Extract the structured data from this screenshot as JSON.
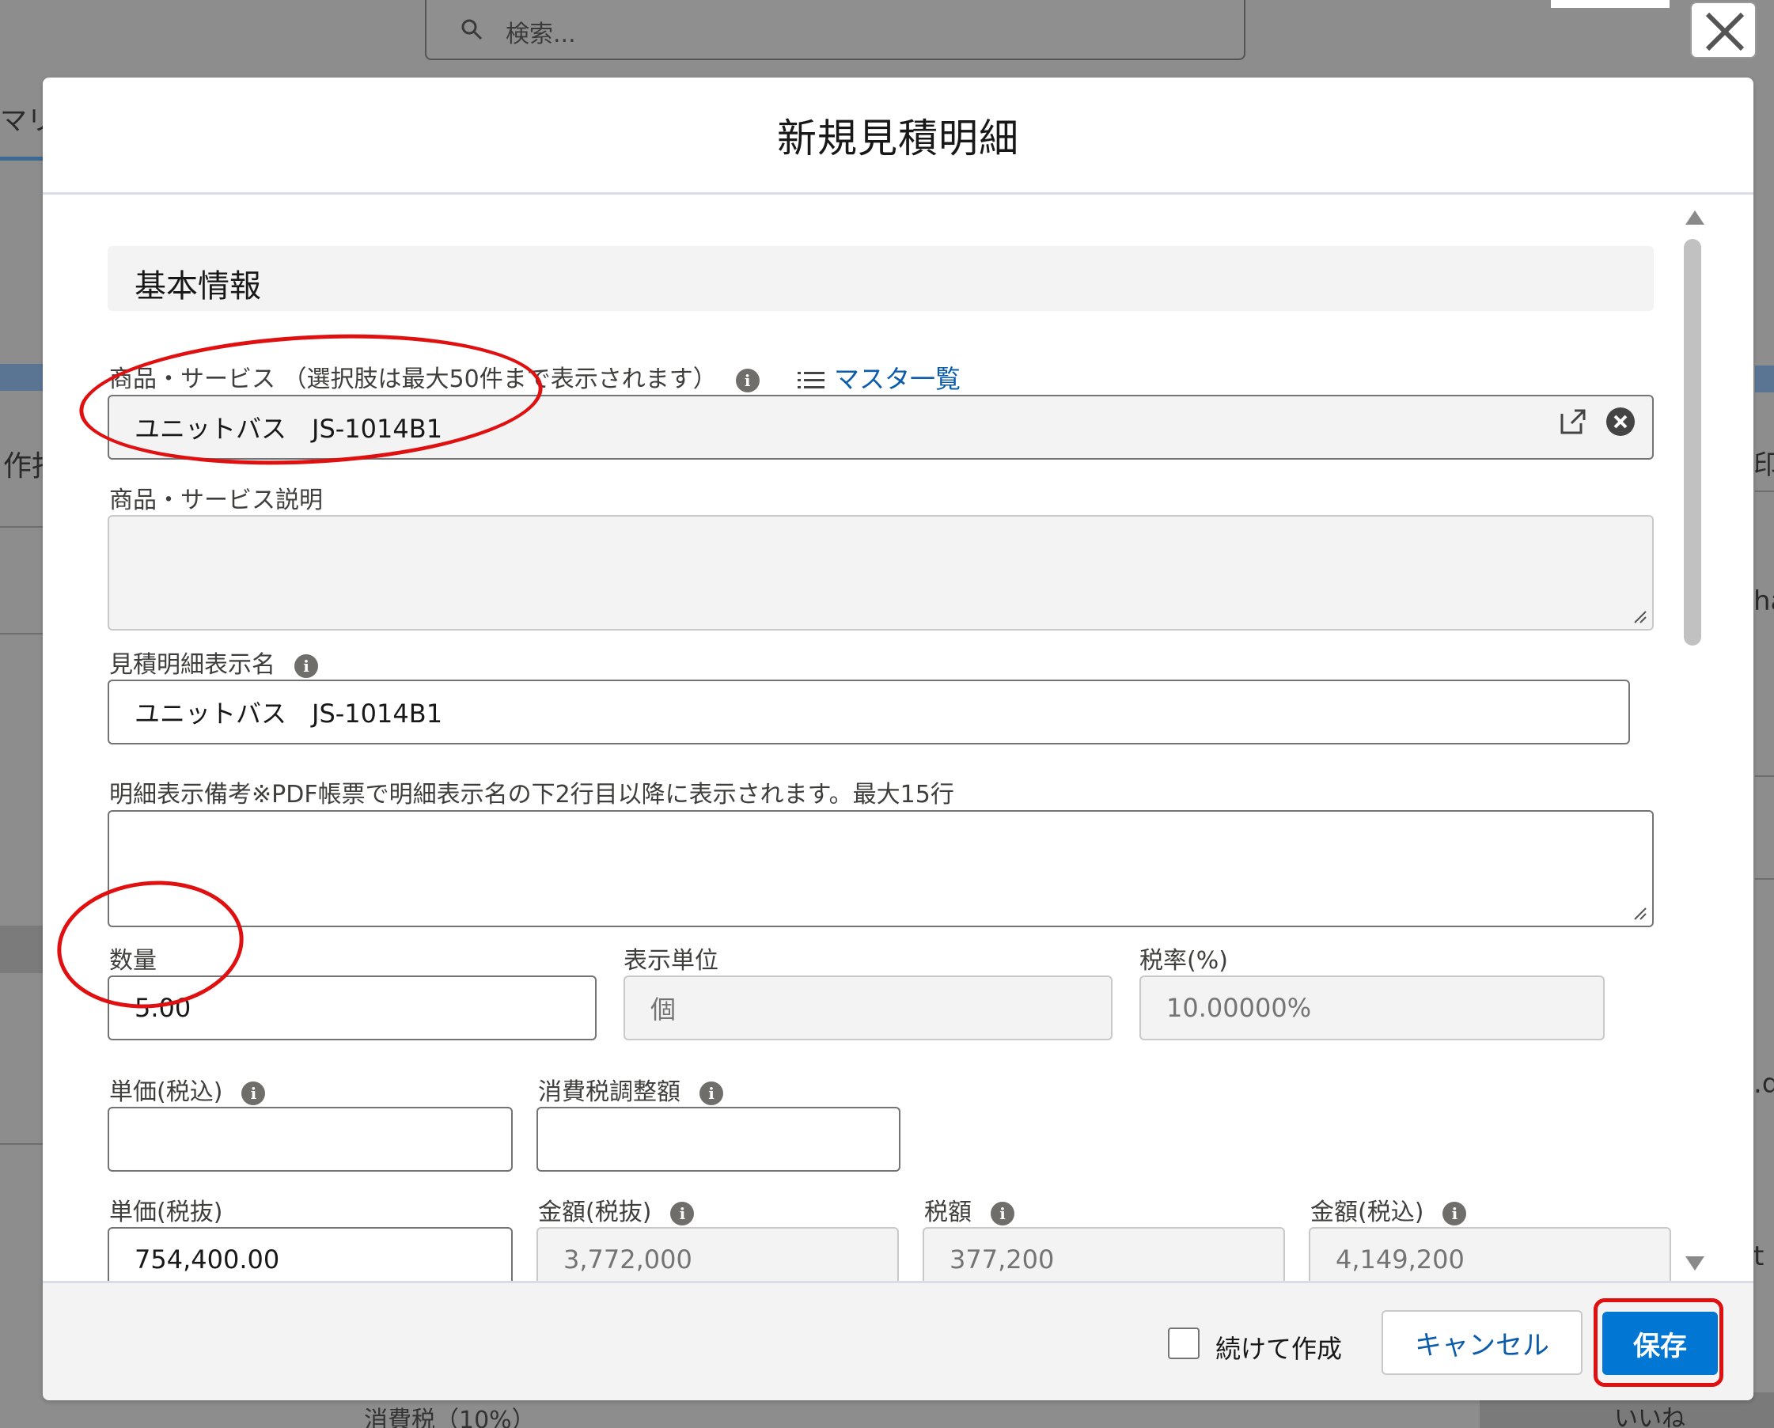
{
  "background": {
    "search_placeholder": "検索...",
    "tab_fragment": "マリ",
    "left_fragment": "作指",
    "right_fragment_1": "印",
    "right_fragment_2": "ha",
    "right_fragment_3": ".d",
    "right_fragment_4": "t",
    "bottom_fragment": "消費税（10%）",
    "bottom_right_fragment": "いいね"
  },
  "modal": {
    "title": "新規見積明細",
    "section_title": "基本情報",
    "product": {
      "label": "商品・サービス （選択肢は最大50件まで表示されます）",
      "value": "ユニットバス　JS-1014B1",
      "master_link": "マスタ一覧"
    },
    "product_description": {
      "label": "商品・サービス説明",
      "value": ""
    },
    "display_name": {
      "label": "見積明細表示名",
      "value": "ユニットバス　JS-1014B1"
    },
    "display_note": {
      "label": "明細表示備考※PDF帳票で明細表示名の下2行目以降に表示されます。最大15行",
      "value": ""
    },
    "quantity": {
      "label": "数量",
      "value": "5.00"
    },
    "unit": {
      "label": "表示単位",
      "value": "個"
    },
    "tax_rate": {
      "label": "税率(%)",
      "value": "10.00000%"
    },
    "unit_price_incl": {
      "label": "単価(税込)",
      "value": ""
    },
    "tax_adjustment": {
      "label": "消費税調整額",
      "value": ""
    },
    "unit_price_excl": {
      "label": "単価(税抜)",
      "value": "754,400.00"
    },
    "amount_excl": {
      "label": "金額(税抜)",
      "value": "3,772,000"
    },
    "tax_amount": {
      "label": "税額",
      "value": "377,200"
    },
    "amount_incl": {
      "label": "金額(税込)",
      "value": "4,149,200"
    }
  },
  "footer": {
    "continue_label": "続けて作成",
    "cancel_label": "キャンセル",
    "save_label": "保存"
  },
  "colors": {
    "brand_blue": "#0176d3",
    "link_blue": "#0b5cab",
    "annotation_red": "#e01010"
  }
}
